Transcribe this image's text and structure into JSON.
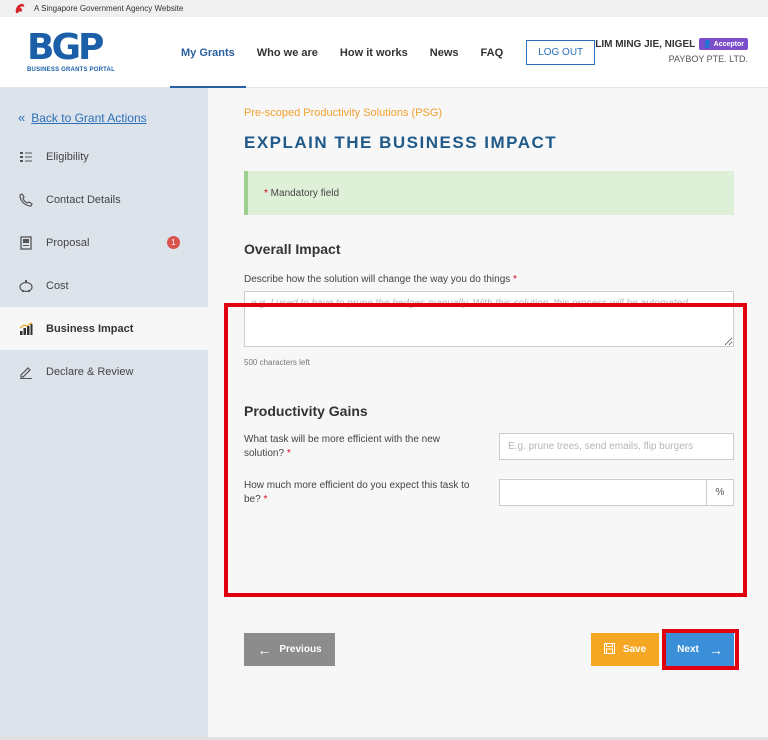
{
  "gov_bar": {
    "text": "A Singapore Government Agency Website"
  },
  "logo": {
    "mark": "BGP",
    "subtitle": "BUSINESS GRANTS PORTAL"
  },
  "nav": {
    "items": [
      {
        "label": "My Grants",
        "active": true
      },
      {
        "label": "Who we are",
        "active": false
      },
      {
        "label": "How it works",
        "active": false
      },
      {
        "label": "News",
        "active": false
      },
      {
        "label": "FAQ",
        "active": false
      }
    ],
    "logout_label": "LOG OUT"
  },
  "user": {
    "name": "LIM MING JIE, NIGEL",
    "role_badge": "Acceptor",
    "company": "PAYBOY PTE. LTD."
  },
  "sidebar": {
    "back_label": "Back to Grant Actions",
    "items": [
      {
        "label": "Eligibility",
        "icon": "list-icon"
      },
      {
        "label": "Contact Details",
        "icon": "phone-icon"
      },
      {
        "label": "Proposal",
        "icon": "document-icon",
        "count": "1"
      },
      {
        "label": "Cost",
        "icon": "piggy-bank-icon"
      },
      {
        "label": "Business Impact",
        "icon": "bar-chart-icon",
        "active": true
      },
      {
        "label": "Declare & Review",
        "icon": "pen-icon"
      }
    ]
  },
  "main": {
    "scheme": "Pre-scoped Productivity Solutions (PSG)",
    "title": "EXPLAIN THE BUSINESS IMPACT",
    "mandatory_note": "Mandatory field",
    "overall_impact": {
      "title": "Overall Impact",
      "question": "Describe how the solution will change the way you do things",
      "placeholder": "e.g. I used to have to prune the hedges manually. With this solution, this process will be automated.",
      "chars_left": "500 characters left"
    },
    "productivity_gains": {
      "title": "Productivity Gains",
      "task_question": "What task will be more efficient with the new solution?",
      "task_placeholder": "E.g. prune trees, send emails, flip burgers",
      "efficiency_question": "How much more efficient do you expect this task to be?",
      "efficiency_unit": "%"
    }
  },
  "buttons": {
    "previous": "Previous",
    "save": "Save",
    "next": "Next"
  },
  "colors": {
    "highlight": "#e00010",
    "primary": "#2a5fa0",
    "save": "#f5a623",
    "next": "#3a8fd8"
  }
}
